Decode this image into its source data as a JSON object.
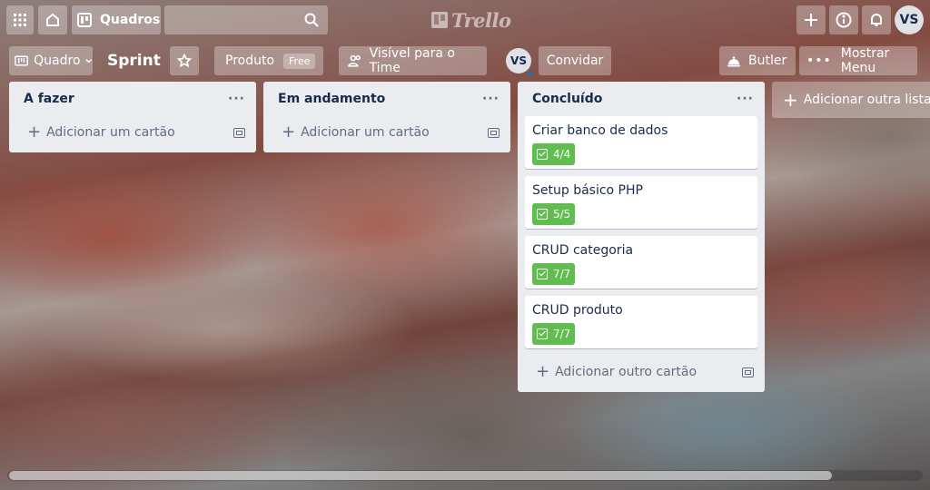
{
  "header": {
    "apps_icon": "grid-icon",
    "home_icon": "home-icon",
    "boards_label": "Quadros",
    "search_placeholder": "",
    "logo_text": "Trello",
    "user_initials": "VS"
  },
  "board_header": {
    "view_label": "Quadro",
    "board_name": "Sprint",
    "workspace_label": "Produto",
    "plan_badge": "Free",
    "visibility_label": "Visível para o Time",
    "member_initials": "VS",
    "invite_label": "Convidar",
    "butler_label": "Butler",
    "menu_label": "Mostrar Menu"
  },
  "lists": [
    {
      "title": "A fazer",
      "cards": [],
      "add_label": "Adicionar um cartão"
    },
    {
      "title": "Em andamento",
      "cards": [],
      "add_label": "Adicionar um cartão"
    },
    {
      "title": "Concluído",
      "cards": [
        {
          "title": "Criar banco de dados",
          "checklist": "4/4"
        },
        {
          "title": "Setup básico PHP",
          "checklist": "5/5"
        },
        {
          "title": "CRUD categoria",
          "checklist": "7/7"
        },
        {
          "title": "CRUD produto",
          "checklist": "7/7"
        }
      ],
      "add_label": "Adicionar outro cartão"
    }
  ],
  "add_list_label": "Adicionar outra lista",
  "colors": {
    "checklist_complete": "#61bd4f",
    "list_bg": "#ebecf0"
  },
  "scrollbar": {
    "position": 0,
    "visible_fraction": 0.9
  }
}
